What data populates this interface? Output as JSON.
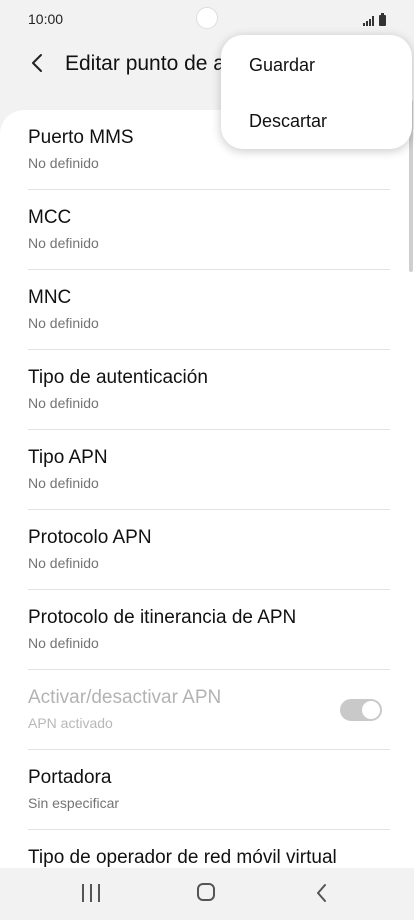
{
  "status_bar": {
    "time": "10:00",
    "icons": [
      "signal-icon",
      "battery-icon"
    ]
  },
  "app_bar": {
    "title": "Editar punto de acceso",
    "back_icon": "chevron-left-icon"
  },
  "menu": {
    "items": [
      {
        "label": "Guardar"
      },
      {
        "label": "Descartar"
      }
    ]
  },
  "settings": {
    "items": [
      {
        "label": "Puerto MMS",
        "value": "No definido"
      },
      {
        "label": "MCC",
        "value": "No definido"
      },
      {
        "label": "MNC",
        "value": "No definido"
      },
      {
        "label": "Tipo de autenticación",
        "value": "No definido"
      },
      {
        "label": "Tipo APN",
        "value": "No definido"
      },
      {
        "label": "Protocolo APN",
        "value": "No definido"
      },
      {
        "label": "Protocolo de itinerancia de APN",
        "value": "No definido"
      },
      {
        "label": "Activar/desactivar APN",
        "value": "APN activado",
        "toggle_on": true,
        "enabled": false
      },
      {
        "label": "Portadora",
        "value": "Sin especificar"
      },
      {
        "label": "Tipo de operador de red móvil virtual",
        "value": ""
      }
    ]
  },
  "nav_bar": {
    "icons": [
      "recents-icon",
      "home-icon",
      "back-icon"
    ]
  },
  "colors": {
    "background": "#f2f2f2",
    "card": "#ffffff",
    "secondary_text": "#737373",
    "disabled_text": "#b3b3b3"
  }
}
